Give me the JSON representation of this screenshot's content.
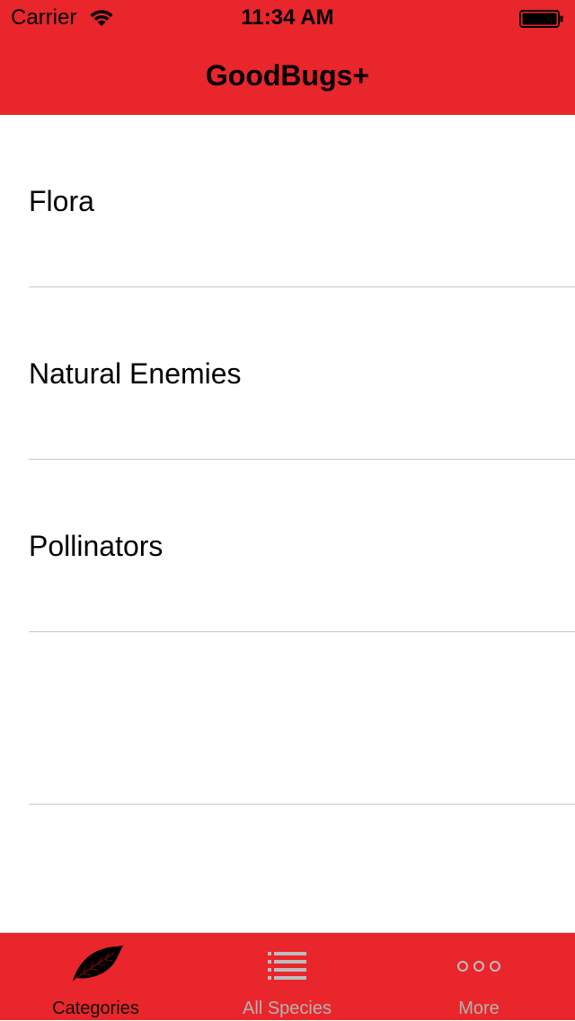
{
  "status_bar": {
    "carrier": "Carrier",
    "time": "11:34 AM"
  },
  "nav": {
    "title": "GoodBugs+"
  },
  "list": {
    "items": [
      {
        "label": "Flora"
      },
      {
        "label": "Natural Enemies"
      },
      {
        "label": "Pollinators"
      },
      {
        "label": ""
      }
    ]
  },
  "tabbar": {
    "tabs": [
      {
        "label": "Categories",
        "icon": "leaf-icon",
        "active": true
      },
      {
        "label": "All Species",
        "icon": "list-icon",
        "active": false
      },
      {
        "label": "More",
        "icon": "more-dots-icon",
        "active": false
      }
    ]
  },
  "colors": {
    "brand_red": "#e8262b",
    "separator": "#c8c7cc",
    "active_tab": "#111111",
    "inactive_tab": "#b3b3b3"
  }
}
